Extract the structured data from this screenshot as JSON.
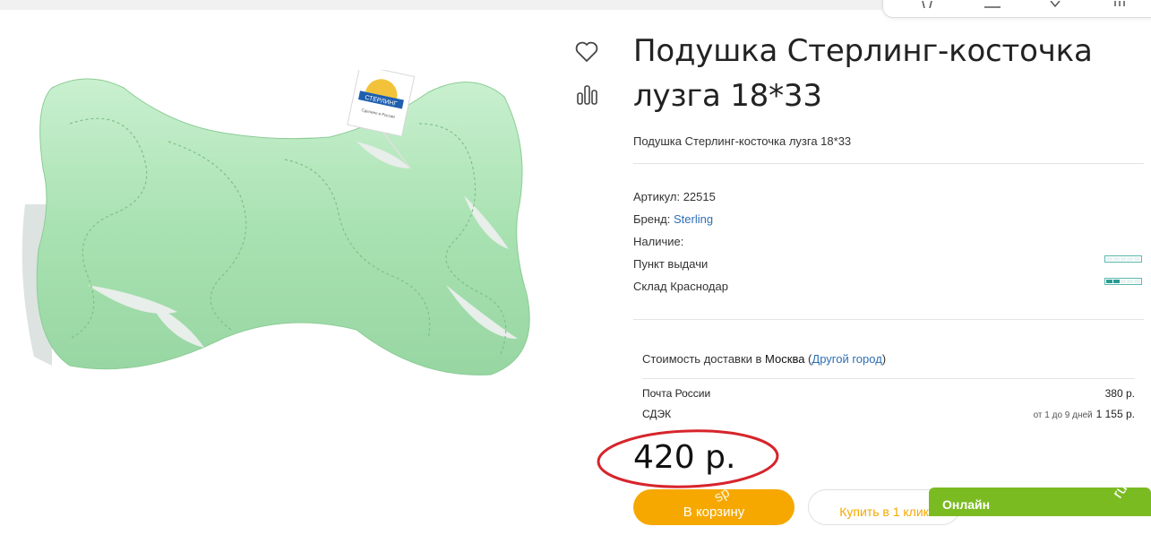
{
  "product": {
    "title": "Подушка Стерлинг-косточка лузга 18*33",
    "subtitle": "Подушка Стерлинг-косточка лузга 18*33",
    "image_label": "СТЕРЛИНГ",
    "image_sublabel": "Сделано в России"
  },
  "info": {
    "article_label": "Артикул:",
    "article_value": "22515",
    "brand_label": "Бренд:",
    "brand_value": "Sterling",
    "availability_label": "Наличие:",
    "pickup_label": "Пункт выдачи",
    "pickup_stock": 0,
    "warehouse_label": "Склад Краснодар",
    "warehouse_stock": 0.4
  },
  "delivery": {
    "prefix": "Стоимость доставки в",
    "city": "Москва",
    "change_city": "Другой город",
    "rows": [
      {
        "name": "Почта России",
        "term": "",
        "price": "380 р."
      },
      {
        "name": "СДЭК",
        "term": "от 1 до 9 дней",
        "price": "1 155 р."
      }
    ]
  },
  "price": "420 р.",
  "buttons": {
    "cart": "В корзину",
    "one_click": "Купить в 1 клик"
  },
  "chat": {
    "label": "Онлайн"
  },
  "watermarks": {
    "left": "sp",
    "right": "ru"
  },
  "colors": {
    "accent": "#f6a800",
    "link": "#2e6fb3",
    "chat": "#7bbb22",
    "highlight": "#d6252b",
    "stock": "#2a9c92"
  },
  "icons": {
    "favorite": "heart-icon",
    "compare": "bar-chart-icon"
  }
}
